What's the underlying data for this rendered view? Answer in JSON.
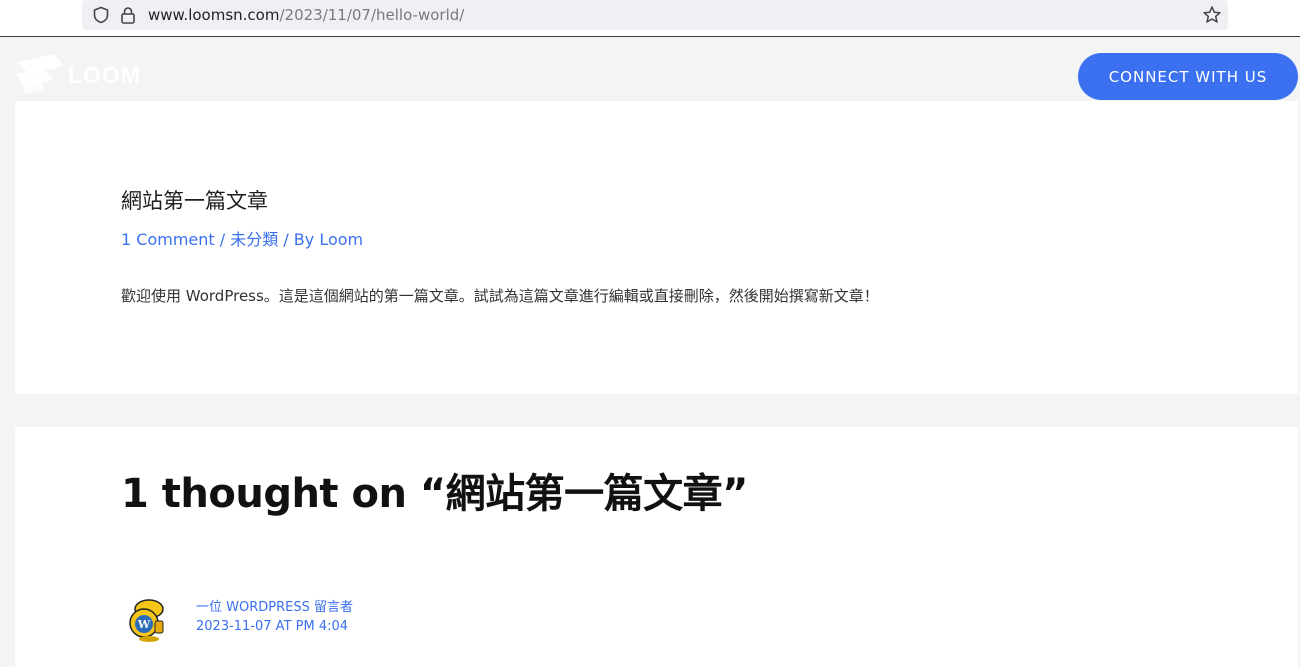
{
  "browser": {
    "url_host": "www.loomsn.com",
    "url_path": "/2023/11/07/hello-world/"
  },
  "header": {
    "logo_text": "LOOM",
    "connect_label": "CONNECT WITH US"
  },
  "article": {
    "title": "網站第一篇文章",
    "meta_comments": "1 Comment",
    "meta_sep1": " / ",
    "meta_category": "未分類",
    "meta_by": " / By ",
    "meta_author": "Loom",
    "body": "歡迎使用 WordPress。這是這個網站的第一篇文章。試試為這篇文章進行編輯或直接刪除，然後開始撰寫新文章！"
  },
  "comments": {
    "title": "1 thought on “網站第一篇文章”",
    "items": [
      {
        "author": "一位 WordPress 留言者",
        "date": "2023-11-07 at PM 4:04"
      }
    ]
  },
  "colors": {
    "accent": "#3b70f0",
    "background": "#f3f4f4"
  }
}
